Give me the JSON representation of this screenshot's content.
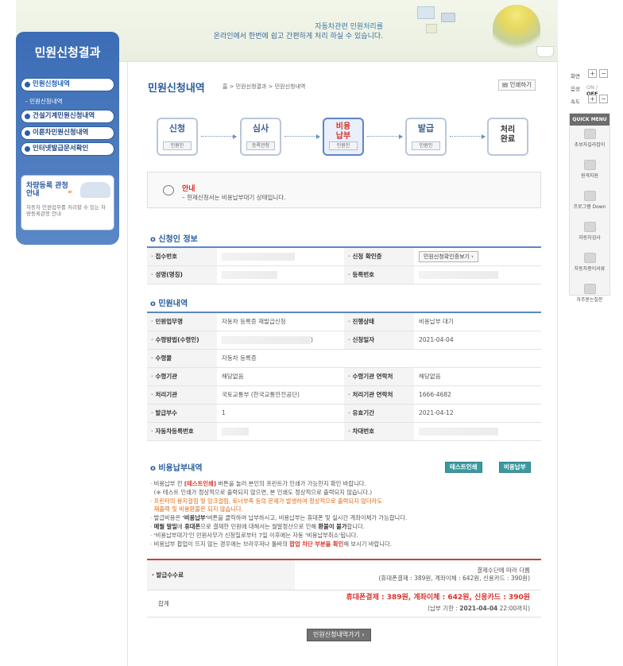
{
  "header": {
    "slogan_line1": "자동차관련 민원처리를",
    "slogan_line2": "온라인에서 한번에 쉽고 간편하게 처리 하실 수 있습니다."
  },
  "leftnav": {
    "title": "민원신청결과",
    "items": [
      {
        "label": "민원신청내역"
      },
      {
        "label": "건설기계민원신청내역"
      },
      {
        "label": "이륜차민원신청내역"
      },
      {
        "label": "인터넷발급문서확인"
      }
    ],
    "sub": "- 민원신청내역",
    "info_title": "차량등록 관청 안내",
    "info_arrow": "»",
    "info_desc": "자동차 민원업무를 처리할 수 있는 차량등록관청 안내"
  },
  "main": {
    "title": "민원신청내역",
    "breadcrumb": "홈 > 민원신청결과 > 민원신청내역",
    "print_label": "인쇄하기",
    "steps": [
      {
        "label": "신청",
        "badge": "민원인"
      },
      {
        "label": "심사",
        "badge": "등록관청"
      },
      {
        "label": "비용\n납부",
        "badge": "민원인"
      },
      {
        "label": "발급",
        "badge": "민원인"
      },
      {
        "label": "처리\n완료",
        "badge": ""
      }
    ],
    "notice": {
      "title": "안내",
      "desc": "– 현재신청서는 비용납부대기 상태입니다."
    },
    "applicant_section": "신청인 정보",
    "applicant": {
      "receipt_no_label": "접수번호",
      "confirm_label": "신청 확인증",
      "confirm_button": "민원신청확인증보기 ›",
      "name_label": "성명(명칭)",
      "reg_no_label": "등록번호"
    },
    "civil_section": "민원내역",
    "civil": {
      "task_label": "민원업무명",
      "task_value": "자동차 등록증 재발급신청",
      "status_label": "진행상태",
      "status_value": "비용납부 대기",
      "method_label": "수령방법(수령인)",
      "method_value": ")",
      "date_label": "신청일자",
      "date_value": "2021-04-04",
      "item_label": "수령물",
      "item_value": "자동차 등록증",
      "agency_label": "수령기관",
      "agency_value": "해당없음",
      "agency_contact_label": "수령기관 연락처",
      "agency_contact_value": "해당없음",
      "proc_label": "처리기관",
      "proc_value": "국토교통부 (한국교통안전공단)",
      "proc_contact_label": "처리기관 연락처",
      "proc_contact_value": "1666-4682",
      "copies_label": "발급부수",
      "copies_value": "1",
      "valid_label": "유효기간",
      "valid_value": "2021-04-12",
      "carreg_label": "자동차등록번호",
      "vin_label": "차대번호"
    },
    "fee_section": "비용납부내역",
    "test_print_button": "테스트인쇄",
    "pay_button": "비용납부",
    "notes": [
      {
        "parts": [
          [
            "n",
            "비용납부 전 "
          ],
          [
            "r",
            "[테스트인쇄]"
          ],
          [
            "n",
            " 버튼을 눌러 본인의 프린트가 인쇄가 가능한지 확인 바랍니다."
          ]
        ]
      },
      {
        "parts": [
          [
            "n",
            "(※ 테스트 인쇄가 정상적으로 출력되지 않으면, 본 인쇄도 정상적으로 출력되지 않습니다.)"
          ]
        ]
      },
      {
        "parts": [
          [
            "o",
            "프린터의 용지걸림 및 잉크걸림, 토너부족 등의 문제가 발생하여 정상적으로 출력되지 않더라도"
          ]
        ]
      },
      {
        "parts": [
          [
            "o",
            "재출력 및 비용환불은 되지 않습니다."
          ]
        ]
      },
      {
        "parts": [
          [
            "n",
            "발급비용은 "
          ],
          [
            "b",
            "'비용납부'"
          ],
          [
            "n",
            "버튼을 클릭하여 납부하시고, 비용납부는 휴대폰 및 실시간 계좌이체가 가능합니다."
          ]
        ]
      },
      {
        "parts": [
          [
            "b",
            "매월 말일"
          ],
          [
            "n",
            "에 "
          ],
          [
            "b",
            "휴대폰"
          ],
          [
            "n",
            "으로 결제한 민원에 대해서는 월말정산으로 인해 "
          ],
          [
            "b",
            "환불이 불가"
          ],
          [
            "n",
            "합니다."
          ]
        ]
      },
      {
        "parts": [
          [
            "n",
            "'비용납부대기'인 민원사무가 신청일로부터 7일 이후에는 자동 '비용납부취소'됩니다."
          ]
        ]
      },
      {
        "parts": [
          [
            "n",
            "비용납부 팝업이 뜨지 않는 경우에는 브라우저나 툴바의 "
          ],
          [
            "r",
            "팝업 차단 부분을 확인"
          ],
          [
            "n",
            "해 보시기 바랍니다."
          ]
        ]
      }
    ],
    "fee": {
      "fee_label": "발급수수료",
      "fee_line1": "결제수단에 따라 다름",
      "fee_line2": "(휴대폰결제 : 389원, 계좌이체 : 642원, 신용카드 : 390원)",
      "total_label": "합계",
      "total_line": "휴대폰결제 : 389원, 계좌이체 : 642원, 신용카드 : 390원",
      "deadline_prefix": "(납부 기한 : ",
      "deadline_date": "2021-04-04",
      "deadline_suffix": " 22:00까지)"
    },
    "back_button": "민원신청내역가기 ›"
  },
  "rightpanel": {
    "screen_label": "화면",
    "sound_label": "음성",
    "sound_on": "ON",
    "sound_sep": " / ",
    "sound_off": "OFF",
    "speed_label": "속도",
    "plus": "+",
    "minus": "−",
    "quick_title": "QUICK MENU",
    "quick_items": [
      {
        "label": "초보자길라잡이"
      },
      {
        "label": "원격지원"
      },
      {
        "label": "프로그램 Down"
      },
      {
        "label": "자동차검사"
      },
      {
        "label": "자동차종이서류"
      },
      {
        "label": "자주묻는질문"
      }
    ]
  }
}
